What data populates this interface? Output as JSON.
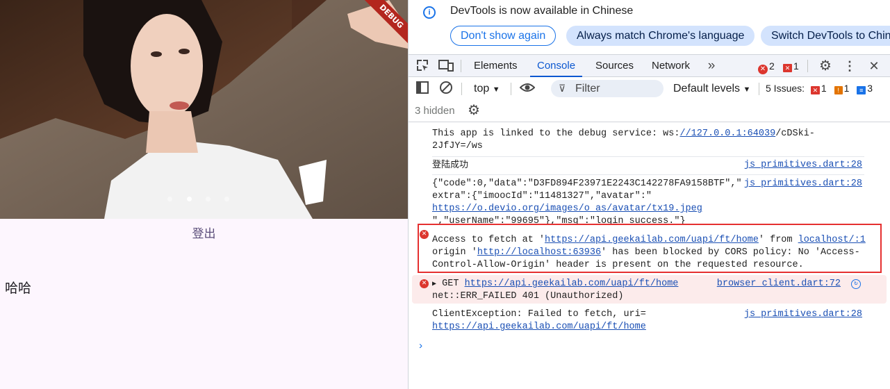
{
  "app": {
    "debug_label": "DEBUG",
    "logout_label": "登出",
    "text": "哈哈",
    "carousel": {
      "count": 4,
      "active": 1
    }
  },
  "devtools": {
    "infobar": {
      "message": "DevTools is now available in Chinese",
      "btn_dont_show": "Don't show again",
      "btn_match": "Always match Chrome's language",
      "btn_switch": "Switch DevTools to Chin"
    },
    "tabs": [
      "Elements",
      "Console",
      "Sources",
      "Network"
    ],
    "active_tab": "Console",
    "error_count": "2",
    "warning_count": "1",
    "toolbar": {
      "context": "top",
      "filter_placeholder": "Filter",
      "levels": "Default levels",
      "issues_label": "5 Issues:",
      "issues_errors": "1",
      "issues_warnings": "1",
      "issues_info": "3"
    },
    "hidden_label": "3 hidden",
    "messages": {
      "m1_text_a": "This app is linked to the debug service: ws:",
      "m1_link": "//127.0.0.1:64039",
      "m1_text_b": "/cDSki-",
      "m1_line2": "2JfJY=/ws",
      "m2_text": "登陆成功",
      "m2_src": "js_primitives.dart:28",
      "m3_line1": "{\"code\":0,\"data\":\"D3FD894F23971E2243C142278FA9158BTF\",\"",
      "m3_line2": "extra\":{\"imoocId\":\"11481327\",\"avatar\":\"",
      "m3_link": "https://o.devio.org/images/o_as/avatar/tx19.jpeg",
      "m3_line4": "\",\"userName\":\"99695\"},\"msg\":\"login success.\"}",
      "m3_src": "js_primitives.dart:28",
      "m4_a": "Access to fetch at '",
      "m4_link1": "https://api.geekailab.com/uapi/ft/home",
      "m4_b": "' from ",
      "m4_link2": "localhost/:1",
      "m4_c": "origin '",
      "m4_link3": "http://localhost:63936",
      "m4_d": "' has been blocked by CORS policy: No 'Access-",
      "m4_e": "Control-Allow-Origin' header is present on the requested resource.",
      "m5_method": "GET",
      "m5_link": "https://api.geekailab.com/uapi/ft/home",
      "m5_src": "browser_client.dart:72",
      "m5_line2": "net::ERR_FAILED 401 (Unauthorized)",
      "m6_line1": "ClientException: Failed to fetch, uri=",
      "m6_link": "https://api.geekailab.com/uapi/ft/home",
      "m6_src": "js_primitives.dart:28"
    }
  },
  "colors": {
    "accent": "#0b57d0",
    "error": "#dc362e",
    "app_bg": "#fdf6fe"
  }
}
